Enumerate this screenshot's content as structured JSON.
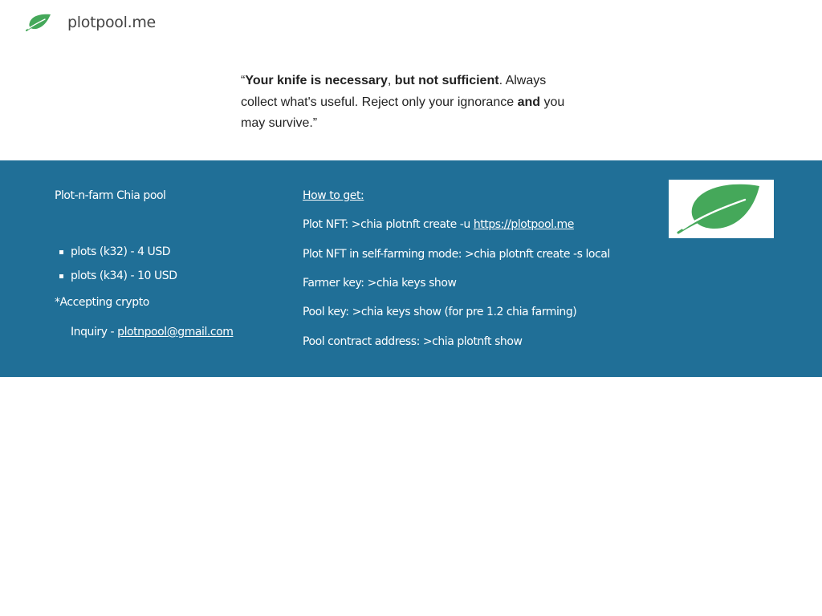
{
  "header": {
    "site_name": "plotpool.me",
    "logo_icon": "leaf-icon",
    "brand_color": "#45a85a"
  },
  "quote": {
    "open_mark": "“",
    "part1_bold": "Your knife is necessary",
    "part2": ", ",
    "part3_bold": "but not sufficient",
    "part4": ". Always collect what's useful. Reject only your ignorance ",
    "part5_bold": "and",
    "part6": " you may survive.”"
  },
  "footer": {
    "background_color": "#206f97",
    "left": {
      "title": "Plot-n-farm Chia pool",
      "prices": [
        "plots (k32) - 4 USD",
        "plots (k34) - 10 USD"
      ],
      "crypto_note": "*Accepting crypto",
      "inquiry_label": "Inquiry - ",
      "inquiry_email": "plotnpool@gmail.com"
    },
    "middle": {
      "heading": "How to get:",
      "plot_nft_label": "Plot NFT: >chia plotnft create -u ",
      "plot_nft_link": "https://plotpool.me",
      "self_farming": "Plot NFT in self-farming mode: >chia plotnft create -s local",
      "farmer_key": "Farmer key:  >chia keys show",
      "pool_key": "Pool key: >chia keys show (for pre 1.2 chia farming)",
      "contract_address": "Pool contract address:  >chia plotnft show"
    },
    "logo_icon": "leaf-icon"
  }
}
